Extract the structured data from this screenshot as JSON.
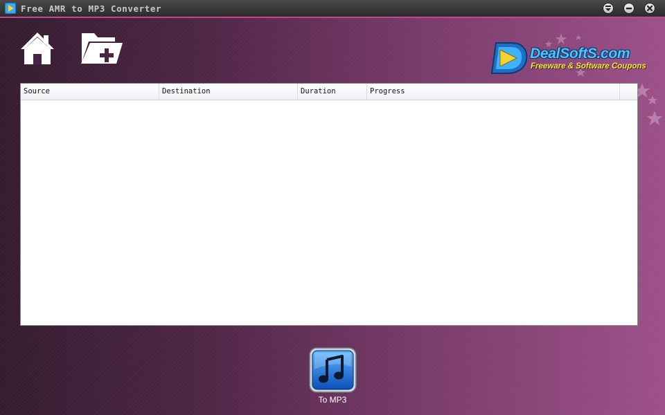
{
  "window": {
    "title": "Free AMR to MP3 Converter"
  },
  "toolbar": {
    "home_icon": "home-icon",
    "add_folder_icon": "folder-add-icon"
  },
  "brand": {
    "name": "DealSoftS.com",
    "tagline": "Freeware & Software Coupons"
  },
  "table": {
    "columns": [
      "Source",
      "Destination",
      "Duration",
      "Progress"
    ],
    "rows": []
  },
  "convert": {
    "label": "To MP3",
    "icon": "music-note-icon"
  },
  "colors": {
    "accent": "#c4468f",
    "logo_blue": "#4fc3ff",
    "logo_yellow": "#f3e34a",
    "button_blue": "#1b6fe0"
  }
}
